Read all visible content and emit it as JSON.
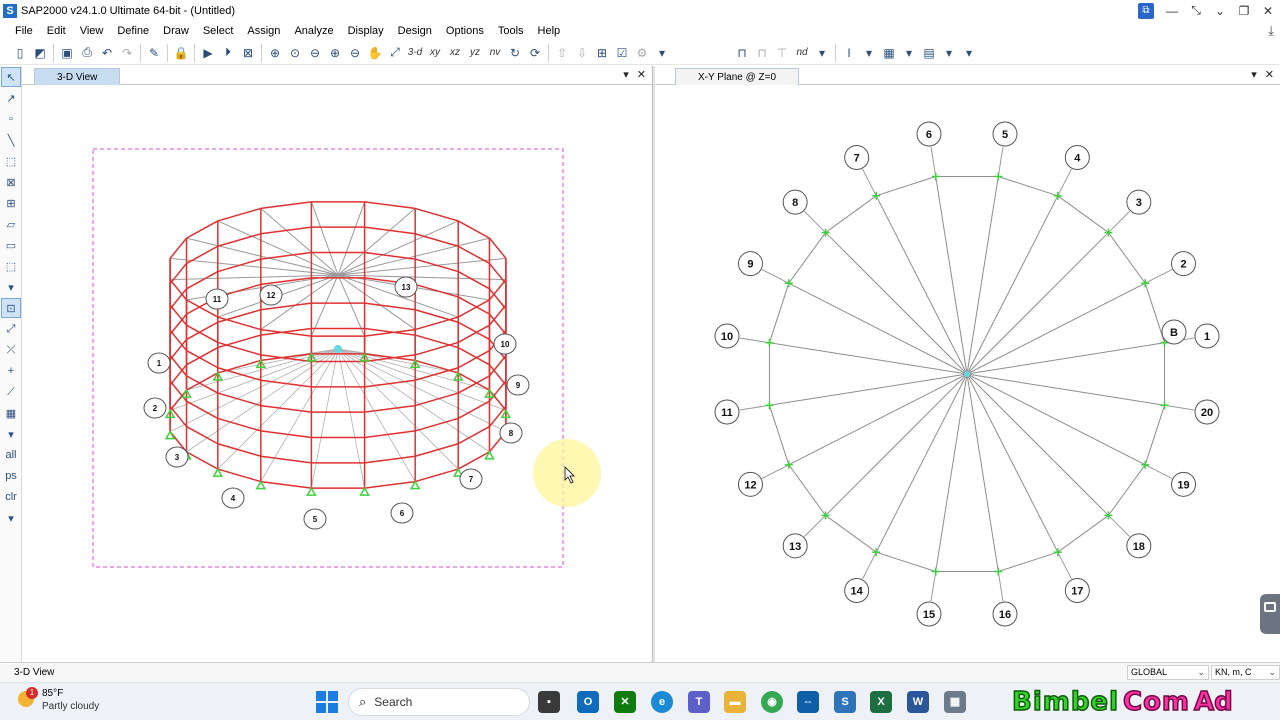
{
  "window": {
    "title": "SAP2000 v24.1.0 Ultimate 64-bit - (Untitled)",
    "app_icon_letter": "S",
    "remote_icon": "remote-desktop-icon",
    "buttons": [
      "minimize-icon",
      "restore-icon",
      "close-icon"
    ]
  },
  "menu": [
    "File",
    "Edit",
    "View",
    "Define",
    "Draw",
    "Select",
    "Assign",
    "Analyze",
    "Display",
    "Design",
    "Options",
    "Tools",
    "Help"
  ],
  "toolbar": {
    "view_labels": [
      "3-d",
      "xy",
      "xz",
      "yz",
      "nv"
    ],
    "nd_label": "nd"
  },
  "left_panel": {
    "tab_label": "3-D View",
    "close_label": "✕",
    "dropdown_label": "▾"
  },
  "right_panel": {
    "tab_label": "X-Y Plane @ Z=0",
    "close_label": "✕",
    "dropdown_label": "▾"
  },
  "plan_view": {
    "node_count": 20,
    "label_text": [
      "1",
      "2",
      "3",
      "4",
      "5",
      "6",
      "7",
      "8",
      "9",
      "10",
      "11",
      "12",
      "13",
      "14",
      "15",
      "16",
      "17",
      "18",
      "19",
      "20"
    ],
    "extra_label": "B"
  },
  "model_3d": {
    "frame_color": "#e03030",
    "rib_color": "#9a9a9a",
    "support_color": "#3ad23a",
    "selection_color": "#e04ad8",
    "labels": [
      "1",
      "2",
      "3",
      "4",
      "5",
      "6",
      "7",
      "8",
      "9",
      "10",
      "11",
      "12",
      "13"
    ]
  },
  "status": {
    "text": "3-D View",
    "coord_system": "GLOBAL",
    "units": "KN, m, C"
  },
  "taskbar": {
    "temperature": "85°F",
    "condition": "Partly cloudy",
    "weather_badge": "1",
    "search_label": "Search",
    "brand_parts": [
      "Bimbel",
      "Com",
      "Ad"
    ]
  }
}
